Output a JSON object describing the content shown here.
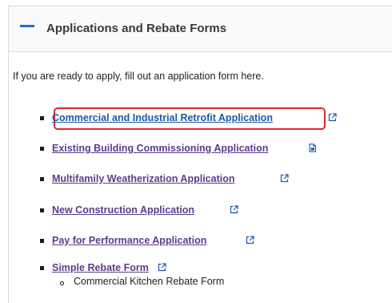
{
  "panel": {
    "title": "Applications and Rebate Forms",
    "expanded": true,
    "intro": "If you are ready to apply, fill out an application form here."
  },
  "links": [
    {
      "label": "Commercial and Industrial Retrofit Application",
      "icon": "external-link-icon",
      "highlighted": true
    },
    {
      "label": "Existing Building Commissioning Application",
      "icon": "document-icon",
      "highlighted": false
    },
    {
      "label": "Multifamily Weatherization Application",
      "icon": "external-link-icon",
      "highlighted": false
    },
    {
      "label": "New Construction Application",
      "icon": "external-link-icon",
      "highlighted": false
    },
    {
      "label": "Pay for Performance Application",
      "icon": "external-link-icon",
      "highlighted": false
    },
    {
      "label": "Simple Rebate Form",
      "icon": "external-link-icon",
      "highlighted": false
    }
  ],
  "sub_items": [
    {
      "label": "Commercial Kitchen Rebate Form"
    }
  ],
  "colors": {
    "accent": "#1b6fc4",
    "link_visited": "#5b3c8c",
    "link": "#1b5aa6",
    "highlight": "#e0262a"
  }
}
